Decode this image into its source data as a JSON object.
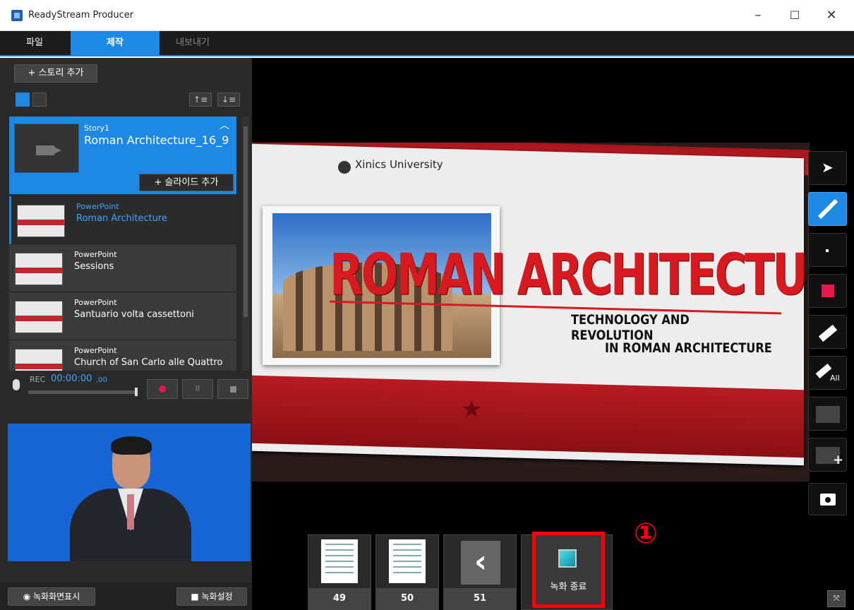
{
  "window": {
    "title": "ReadyStream Producer",
    "minimize": "–",
    "maximize": "☐",
    "close": "✕"
  },
  "menu": {
    "tabs": [
      {
        "label": "파일"
      },
      {
        "label": "제작"
      },
      {
        "label": "내보내기"
      }
    ]
  },
  "sidebar": {
    "add_story": "+ 스토리 추가",
    "story": {
      "label": "Story1",
      "title": "Roman Architecture_16_9",
      "add_slide": "+ 슬라이드 추가"
    },
    "slides": [
      {
        "type": "PowerPoint",
        "name": "Roman Architecture"
      },
      {
        "type": "PowerPoint",
        "name": "Sessions"
      },
      {
        "type": "PowerPoint",
        "name": "Santuario volta cassettoni"
      },
      {
        "type": "PowerPoint",
        "name": "Church of San Carlo alle Quattro"
      }
    ],
    "rec": {
      "label": "REC",
      "time": "00:00:00",
      "time_frac": ".00"
    },
    "show_record_screen": "녹화화면표시",
    "record_settings": "녹화설정"
  },
  "slide": {
    "university": "Xinics University",
    "title": "ROMAN ARCHITECTURE",
    "subtitle1": "TECHNOLOGY AND REVOLUTION",
    "subtitle2": "IN ROMAN ARCHITECTURE"
  },
  "thumbs": [
    {
      "page": "49"
    },
    {
      "page": "50"
    },
    {
      "page": "51"
    }
  ],
  "end_recording": "녹화 종료",
  "annotation": "①",
  "colors": {
    "accent": "#1e88e5",
    "pen_color": "#e8174a",
    "highlight": "#ff0000"
  }
}
